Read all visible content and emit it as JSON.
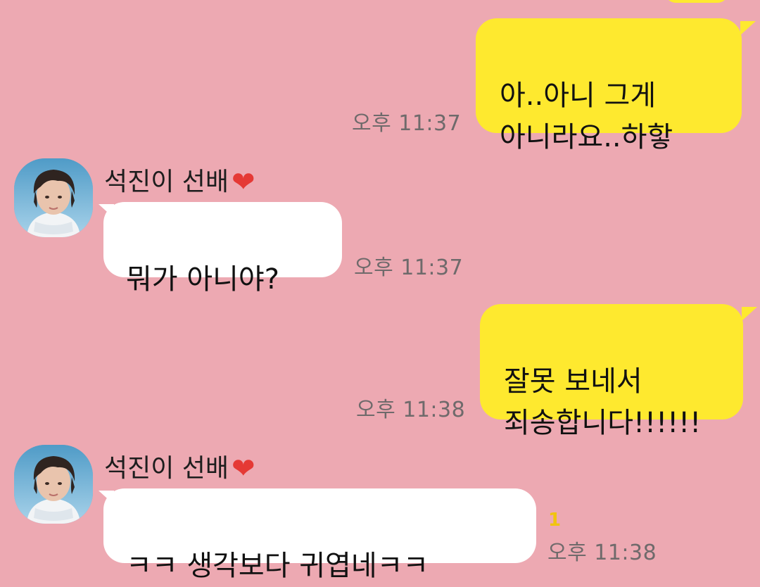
{
  "conversation": {
    "messages": [
      {
        "side": "me",
        "text": "아..아니 그게\n아니라요..하핳",
        "time": "오후 11:37"
      },
      {
        "side": "them",
        "sender": "석진이 선배",
        "text": "뭐가 아니야?",
        "time": "오후 11:37"
      },
      {
        "side": "me",
        "text": "잘못 보네서\n죄송합니다!!!!!!",
        "time": "오후 11:38"
      },
      {
        "side": "them",
        "sender": "석진이 선배",
        "text": "ㅋㅋ 생각보다 귀엽네ㅋㅋ",
        "time": "오후 11:38",
        "unread": "1"
      }
    ],
    "heart_icon": "❤"
  },
  "colors": {
    "background": "#EDA9B2",
    "my_bubble": "#FEE92F",
    "their_bubble": "#FFFFFF",
    "unread_count": "#F1C40F"
  }
}
